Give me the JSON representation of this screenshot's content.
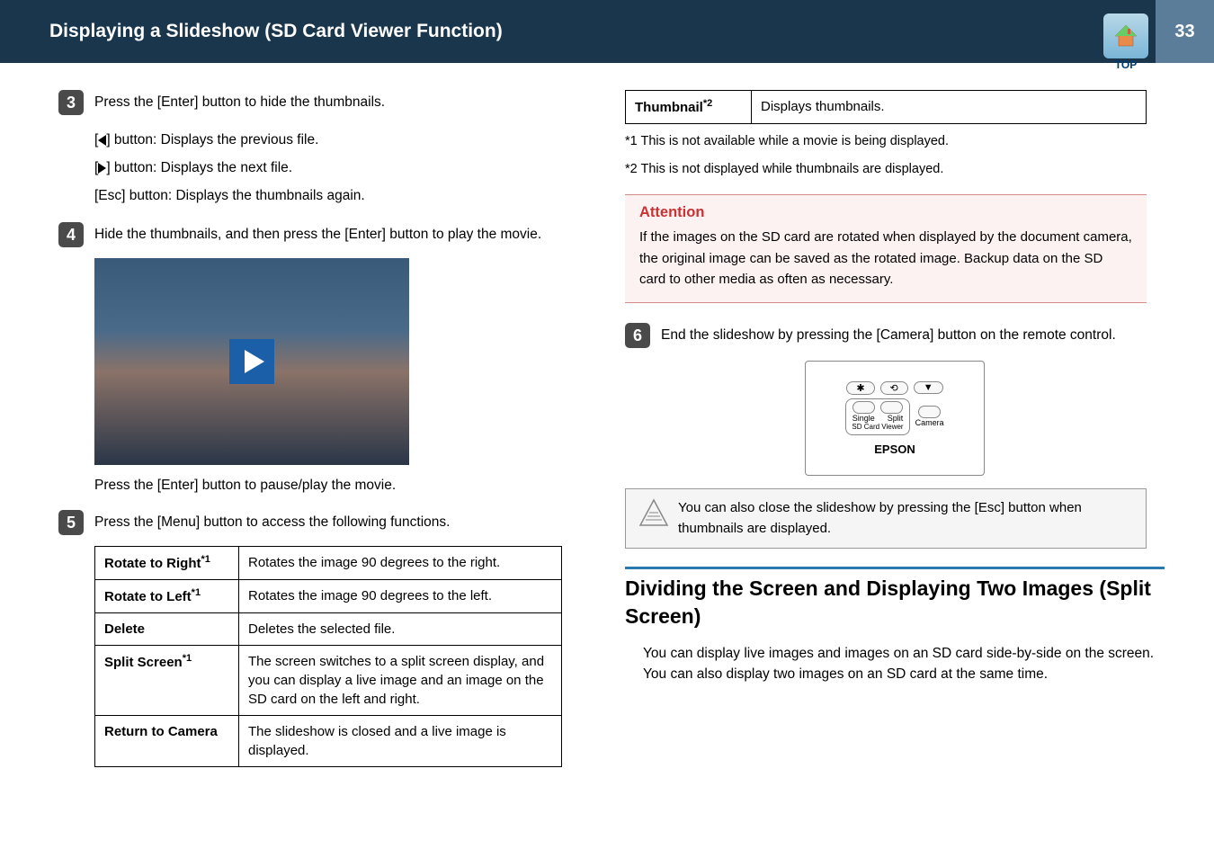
{
  "header": {
    "title": "Displaying a Slideshow (SD Card Viewer Function)",
    "topLabel": "TOP",
    "pageNumber": "33"
  },
  "left": {
    "step3": {
      "text": "Press the [Enter] button to hide the thumbnails.",
      "bullets": {
        "prev": "[ ◀ ] button: Displays the previous file.",
        "next": "[ ▶ ] button: Displays the next file.",
        "esc": "[Esc] button: Displays the thumbnails again."
      }
    },
    "step4": {
      "text": "Hide the thumbnails, and then press the [Enter] button to play the movie.",
      "afterImg": "Press the [Enter] button to pause/play the movie."
    },
    "step5": {
      "text": "Press the [Menu] button to access the following functions.",
      "table": [
        {
          "name": "Rotate to Right*1",
          "desc": "Rotates the image 90 degrees to the right."
        },
        {
          "name": "Rotate to Left*1",
          "desc": "Rotates the image 90 degrees to the left."
        },
        {
          "name": "Delete",
          "desc": "Deletes the selected file."
        },
        {
          "name": "Split Screen*1",
          "desc": "The screen switches to a split screen display, and you can display a live image and an image on the SD card on the left and right."
        },
        {
          "name": "Return to Camera",
          "desc": "The slideshow is closed and a live image is displayed."
        }
      ]
    }
  },
  "right": {
    "thumbTable": {
      "name": "Thumbnail*2",
      "desc": "Displays thumbnails."
    },
    "footnote1": "*1 This is not available while a movie is being displayed.",
    "footnote2": "*2 This is not displayed while thumbnails are displayed.",
    "attention": {
      "title": "Attention",
      "text": "If the images on the SD card are rotated when displayed by the document camera, the original image can be saved as the rotated image. Backup data on the SD card to other media as often as necessary."
    },
    "step6": {
      "text": "End the slideshow by pressing the [Camera] button on the remote control.",
      "remote": {
        "single": "Single",
        "split": "Split",
        "camera": "Camera",
        "sdviewer": "SD Card Viewer",
        "brand": "EPSON"
      }
    },
    "tip": "You can also close the slideshow by pressing the [Esc] button when thumbnails are displayed.",
    "section": {
      "heading": "Dividing the Screen and Displaying Two Images (Split Screen)",
      "text": "You can display live images and images on an SD card side-by-side on the screen. You can also display two images on an SD card at the same time."
    }
  }
}
